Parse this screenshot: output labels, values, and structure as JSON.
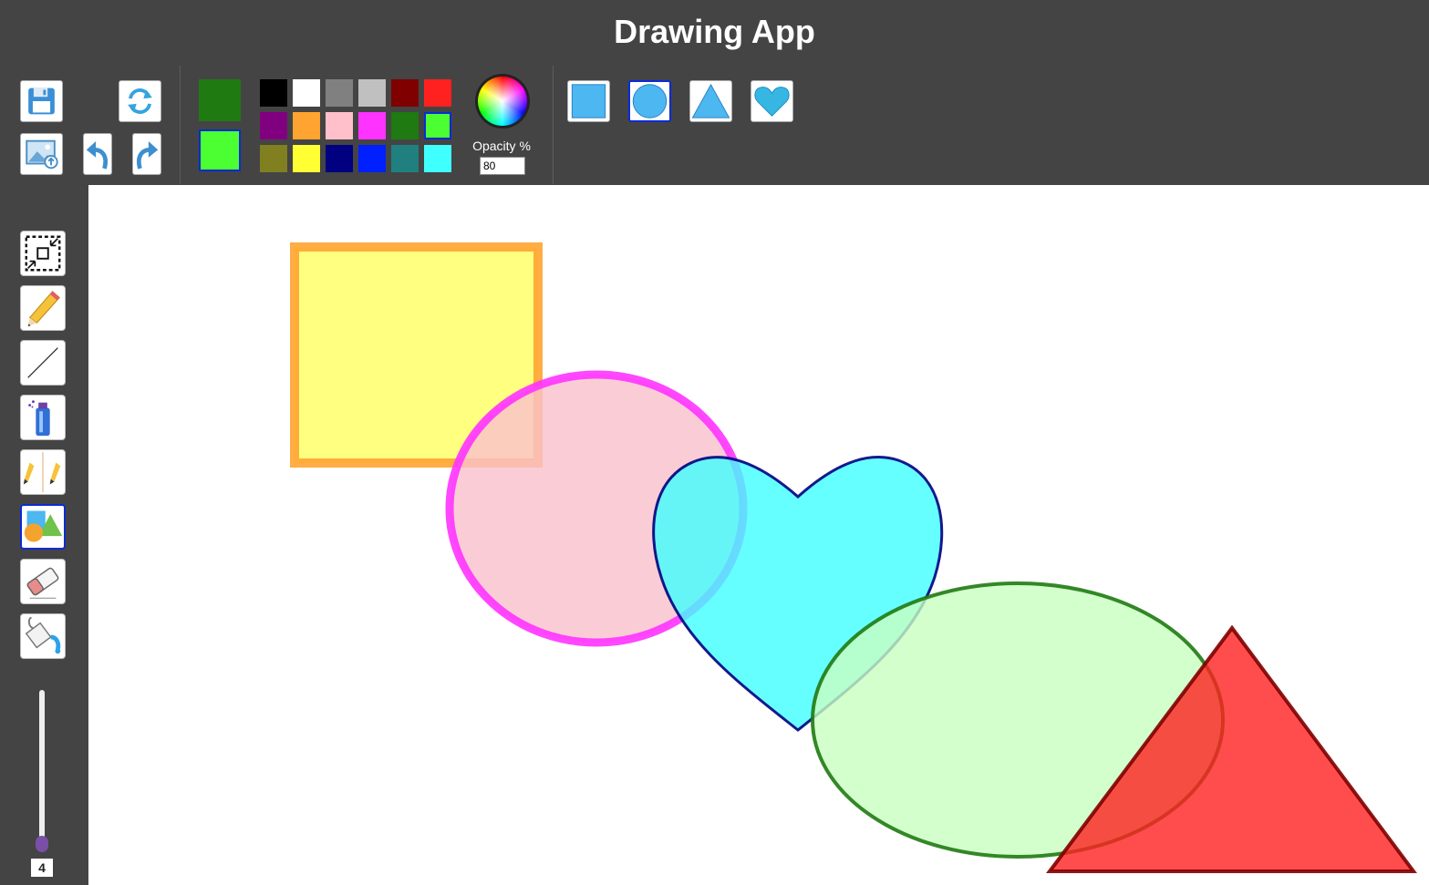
{
  "app": {
    "title": "Drawing App"
  },
  "toolbar": {
    "actions": [
      {
        "name": "save-button",
        "icon": "floppy-disk-icon"
      },
      {
        "name": "reset-button",
        "icon": "refresh-icon"
      },
      {
        "name": "upload-image-button",
        "icon": "image-upload-icon"
      },
      {
        "name": "undo-button",
        "icon": "undo-arrow-icon"
      },
      {
        "name": "redo-button",
        "icon": "redo-arrow-icon"
      }
    ],
    "stroke_color": "#1f7a12",
    "fill_color": "#4cff33",
    "palette": [
      "#000000",
      "#ffffff",
      "#808080",
      "#c0c0c0",
      "#800000",
      "#ff2020",
      "#800080",
      "#ffa430",
      "#ffc0cb",
      "#ff33ff",
      "#1f7a12",
      "#4cff33",
      "#808020",
      "#ffff33",
      "#000080",
      "#0020ff",
      "#208080",
      "#40ffff"
    ],
    "selected_palette_color": "#4cff33",
    "color_picker_icon": "color-wheel-icon",
    "opacity_label": "Opacity %",
    "opacity_value": "80",
    "shapes": [
      {
        "name": "rectangle",
        "icon": "square-shape-icon",
        "selected": false
      },
      {
        "name": "circle",
        "icon": "circle-shape-icon",
        "selected": true
      },
      {
        "name": "triangle",
        "icon": "triangle-shape-icon",
        "selected": false
      },
      {
        "name": "heart",
        "icon": "heart-shape-icon",
        "selected": false
      }
    ],
    "shape_color": "#4cb7f0"
  },
  "sidebar": {
    "tools": [
      {
        "name": "select",
        "icon": "selection-resize-icon",
        "selected": false
      },
      {
        "name": "pencil",
        "icon": "pencil-icon",
        "selected": false
      },
      {
        "name": "line",
        "icon": "line-icon",
        "selected": false
      },
      {
        "name": "spray",
        "icon": "spray-can-icon",
        "selected": false
      },
      {
        "name": "mirror",
        "icon": "mirror-pencils-icon",
        "selected": false
      },
      {
        "name": "shapes",
        "icon": "shapes-icon",
        "selected": true
      },
      {
        "name": "eraser",
        "icon": "eraser-icon",
        "selected": false
      },
      {
        "name": "fill",
        "icon": "paint-bucket-icon",
        "selected": false
      }
    ],
    "brush_size": "4"
  },
  "canvas": {
    "shapes": [
      {
        "type": "rectangle",
        "stroke": "#ffa430",
        "fill": "#ffff80"
      },
      {
        "type": "ellipse",
        "stroke": "#ff33ff",
        "fill": "#f9c1cc"
      },
      {
        "type": "heart",
        "stroke": "#000080",
        "fill": "#40ffff"
      },
      {
        "type": "ellipse",
        "stroke": "#1f7a12",
        "fill": "#c8ffc0"
      },
      {
        "type": "triangle",
        "stroke": "#800000",
        "fill": "#ff2020"
      }
    ]
  }
}
